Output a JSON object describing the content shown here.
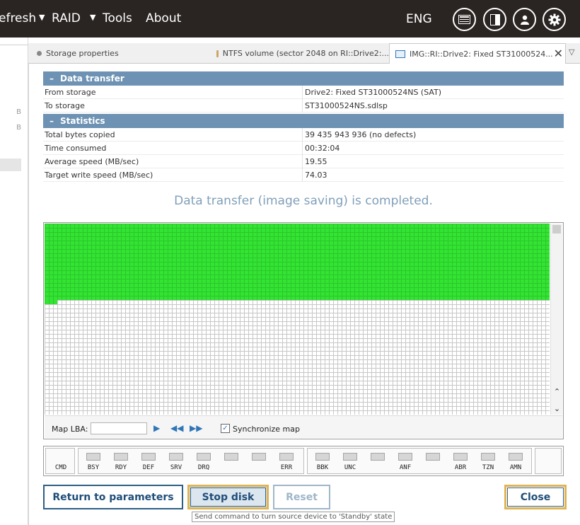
{
  "menu": {
    "items": [
      {
        "label": "efresh"
      },
      {
        "label": "RAID"
      },
      {
        "label": "Tools"
      },
      {
        "label": "About"
      }
    ],
    "language": "ENG",
    "icons": [
      "window-icon",
      "panel-icon",
      "user-icon",
      "gear-icon"
    ]
  },
  "sidebar": {
    "items": [
      "B",
      "B"
    ]
  },
  "tabs": [
    {
      "label": "Storage properties",
      "icon": "dot-icon"
    },
    {
      "label": "NTFS volume (sector 2048 on RI::Drive2:...",
      "icon": "folder-icon"
    },
    {
      "label": "IMG::RI::Drive2: Fixed ST31000524...",
      "icon": "disk-image-icon",
      "active": true
    }
  ],
  "data_transfer": {
    "title": "Data transfer",
    "rows": [
      {
        "key": "From storage",
        "value": "Drive2: Fixed ST31000524NS (SAT)"
      },
      {
        "key": "To storage",
        "value": "ST31000524NS.sdlsp"
      }
    ]
  },
  "statistics": {
    "title": "Statistics",
    "rows": [
      {
        "key": "Total bytes copied",
        "value": "39 435 943 936 (no defects)"
      },
      {
        "key": "Time consumed",
        "value": "00:32:04"
      },
      {
        "key": "Average speed (MB/sec)",
        "value": "19.55"
      },
      {
        "key": "Target write speed (MB/sec)",
        "value": "74.03"
      }
    ]
  },
  "status_message": "Data transfer (image saving) is completed.",
  "map": {
    "lba_label": "Map LBA:",
    "lba_value": "",
    "sync_label": "Synchronize map",
    "sync_checked": true,
    "completed_fraction": 0.4,
    "colors": {
      "done": "#33e433",
      "empty": "#ffffff"
    }
  },
  "indicators": {
    "cmd": "CMD",
    "group1": [
      "BSY",
      "RDY",
      "DEF",
      "SRV",
      "DRQ",
      "",
      "",
      "ERR"
    ],
    "group2": [
      "BBK",
      "UNC",
      "",
      "ANF",
      "",
      "ABR",
      "TZN",
      "AMN"
    ]
  },
  "buttons": {
    "return": "Return to parameters",
    "stop": "Stop disk",
    "reset": "Reset",
    "close": "Close"
  },
  "tooltip": "Send command to turn source device to 'Standby' state",
  "colors": {
    "topbar": "#2a2523",
    "section_header": "#6d92b3",
    "button_border": "#2d5f86",
    "focus_ring": "#e0b453",
    "status_text": "#7f9fb9"
  }
}
